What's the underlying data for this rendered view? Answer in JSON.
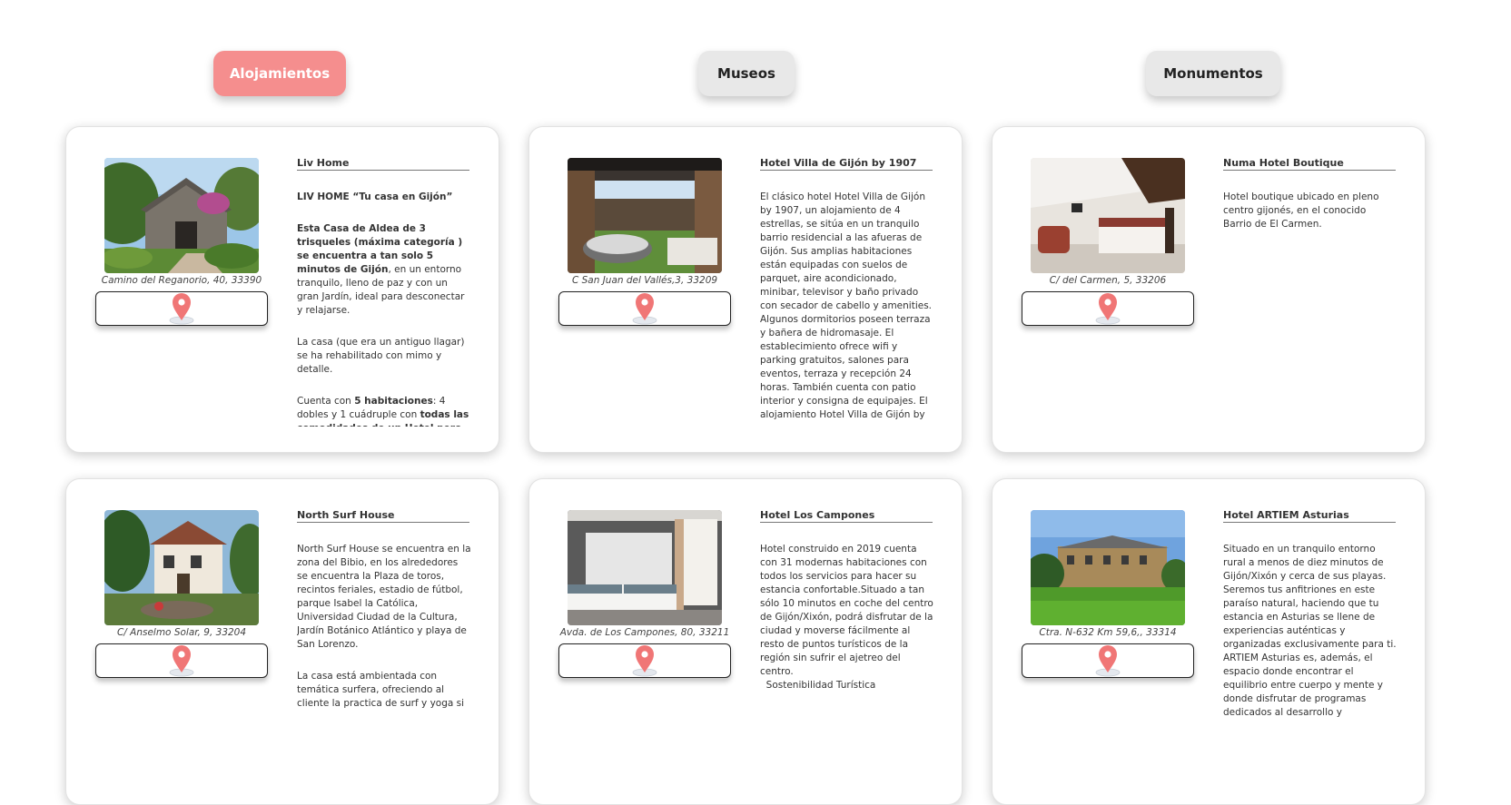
{
  "tabs": [
    {
      "label": "Alojamientos",
      "active": true
    },
    {
      "label": "Museos",
      "active": false
    },
    {
      "label": "Monumentos",
      "active": false
    }
  ],
  "colors": {
    "accent": "#f58e8e",
    "pin": "#f07676",
    "inactive_tab": "#e8e8e8"
  },
  "cards": [
    {
      "name": "Liv Home",
      "address": "Camino del Reganorio, 40, 33390",
      "photo": "stone-cottage-photo",
      "description": {
        "p1": "LIV HOME “Tu casa en Gijón”",
        "p2_bold": "Esta Casa de Aldea de 3 trisqueles (máxima categoría ) se encuentra a tan solo 5 minutos de Gijón",
        "p2_rest": ", en un entorno tranquilo, lleno de paz y con un gran Jardín, ideal para desconectar y relajarse.",
        "p3": "La casa (que era un antiguo llagar) se ha rehabilitado con mimo y detalle.",
        "p4_a": "Cuenta con ",
        "p4_b": "5 habitaciones",
        "p4_c": ": 4 dobles y 1 cuádruple con ",
        "p4_d": "todas las comodidades de un Hotel pero con"
      }
    },
    {
      "name": "Hotel Villa de Gijón by 1907",
      "address": "C San Juan del Vallés,3, 33209",
      "photo": "terrace-jacuzzi-photo",
      "description": {
        "p1": "El clásico hotel Hotel Villa de Gijón by 1907, un alojamiento de 4 estrellas, se sitúa en un tranquilo barrio residencial a las afueras de Gijón. Sus amplias habitaciones están equipadas con suelos de parquet, aire acondicionado, minibar, televisor y baño privado con secador de cabello y amenities. Algunos dormitorios poseen terraza y bañera de hidromasaje. El establecimiento ofrece wifi y parking gratuitos, salones para eventos, terraza y recepción 24 horas. También cuenta con patio interior y consigna de equipajes. El alojamiento Hotel Villa de Gijón by"
      }
    },
    {
      "name": "Numa Hotel Boutique",
      "address": "C/ del Carmen, 5, 33206",
      "photo": "hotel-bedroom-photo",
      "description": {
        "p1": "Hotel boutique ubicado en pleno centro gijonés, en el conocido Barrio de El Carmen."
      }
    },
    {
      "name": "North Surf House",
      "address": "C/ Anselmo Solar, 9, 33204",
      "photo": "surf-house-photo",
      "description": {
        "p1": "North Surf House se encuentra en la zona del Bibio, en los alrededores se encuentra la Plaza de toros, recintos feriales, estadio de fútbol, parque Isabel la Católica, Universidad Ciudad de la Cultura, Jardín Botánico Atlántico y playa de San Lorenzo.",
        "p2": "La casa está ambientada con temática surfera, ofreciendo al cliente la practica de surf y yoga si"
      }
    },
    {
      "name": "Hotel Los Campones",
      "address": "Avda. de Los Campones, 80, 33211",
      "photo": "twin-room-photo",
      "description": {
        "p1": "Hotel construido en 2019 cuenta con 31 modernas habitaciones con todos los servicios para hacer su estancia confortable.Situado a tan sólo 10 minutos en coche del centro de Gijón/Xixón, podrá disfrutar de la ciudad y moverse fácilmente al resto de puntos turísticos de la región sin sufrir el ajetreo del centro.",
        "p2": "  Sostenibilidad Turística"
      }
    },
    {
      "name": "Hotel ARTIEM Asturias",
      "address": "Ctra. N-632 Km 59,6,, 33314",
      "photo": "country-hotel-photo",
      "description": {
        "p1": "Situado en un tranquilo entorno rural a menos de diez minutos de Gijón/Xixón y cerca de sus playas. Seremos tus anfitriones en este paraíso natural, haciendo que tu estancia en Asturias se llene de experiencias auténticas y organizadas exclusivamente para ti. ARTIEM Asturias es, además, el espacio donde encontrar el equilibrio entre cuerpo y mente y donde disfrutar de programas dedicados al desarrollo y"
      }
    }
  ]
}
